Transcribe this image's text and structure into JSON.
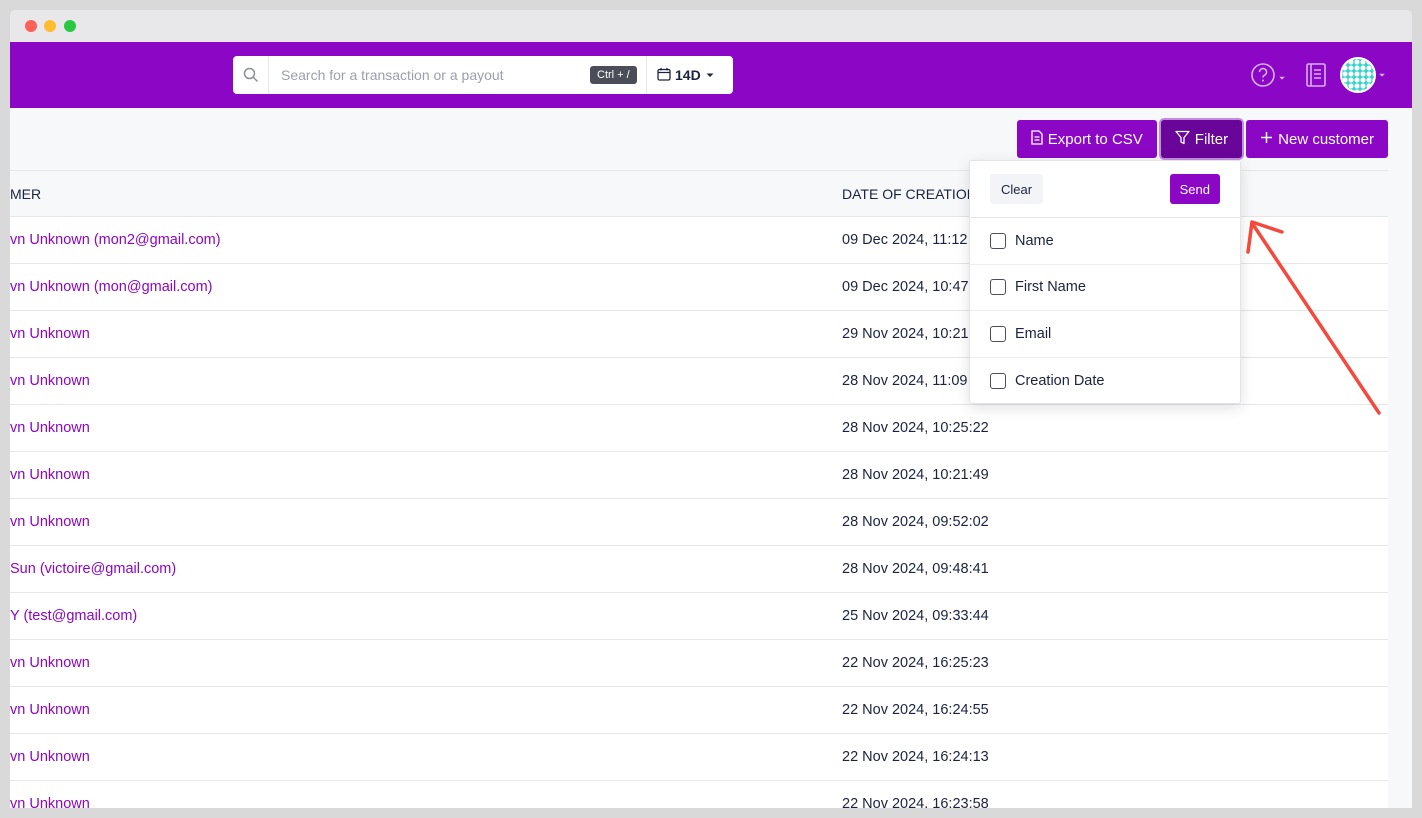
{
  "search": {
    "placeholder": "Search for a transaction or a payout",
    "shortcut": "Ctrl + /"
  },
  "date_range": {
    "label": "14D"
  },
  "toolbar": {
    "export_label": "Export to CSV",
    "filter_label": "Filter",
    "new_customer_label": "New customer"
  },
  "table": {
    "headers": {
      "customer": "MER",
      "date": "DATE OF CREATION"
    },
    "rows": [
      {
        "customer": "vn Unknown (mon2@gmail.com)",
        "date": "09 Dec 2024, 11:12"
      },
      {
        "customer": "vn Unknown (mon@gmail.com)",
        "date": "09 Dec 2024, 10:47"
      },
      {
        "customer": "vn Unknown",
        "date": "29 Nov 2024, 10:21"
      },
      {
        "customer": "vn Unknown",
        "date": "28 Nov 2024, 11:09"
      },
      {
        "customer": "vn Unknown",
        "date": "28 Nov 2024, 10:25:22"
      },
      {
        "customer": "vn Unknown",
        "date": "28 Nov 2024, 10:21:49"
      },
      {
        "customer": "vn Unknown",
        "date": "28 Nov 2024, 09:52:02"
      },
      {
        "customer": "Sun (victoire@gmail.com)",
        "date": "28 Nov 2024, 09:48:41"
      },
      {
        "customer": "Y (test@gmail.com)",
        "date": "25 Nov 2024, 09:33:44"
      },
      {
        "customer": "vn Unknown",
        "date": "22 Nov 2024, 16:25:23"
      },
      {
        "customer": "vn Unknown",
        "date": "22 Nov 2024, 16:24:55"
      },
      {
        "customer": "vn Unknown",
        "date": "22 Nov 2024, 16:24:13"
      },
      {
        "customer": "vn Unknown",
        "date": "22 Nov 2024, 16:23:58"
      }
    ]
  },
  "filter_dropdown": {
    "clear_label": "Clear",
    "send_label": "Send",
    "options": [
      "Name",
      "First Name",
      "Email",
      "Creation Date"
    ]
  },
  "colors": {
    "brand": "#8b07c5",
    "brand_dark": "#6a0599",
    "text": "#1b2340",
    "annotation_arrow": "#f4493c"
  },
  "icons": [
    "search-icon",
    "calendar-icon",
    "chevron-down-icon",
    "help-icon",
    "book-icon",
    "avatar",
    "file-icon",
    "filter-icon",
    "plus-icon"
  ]
}
